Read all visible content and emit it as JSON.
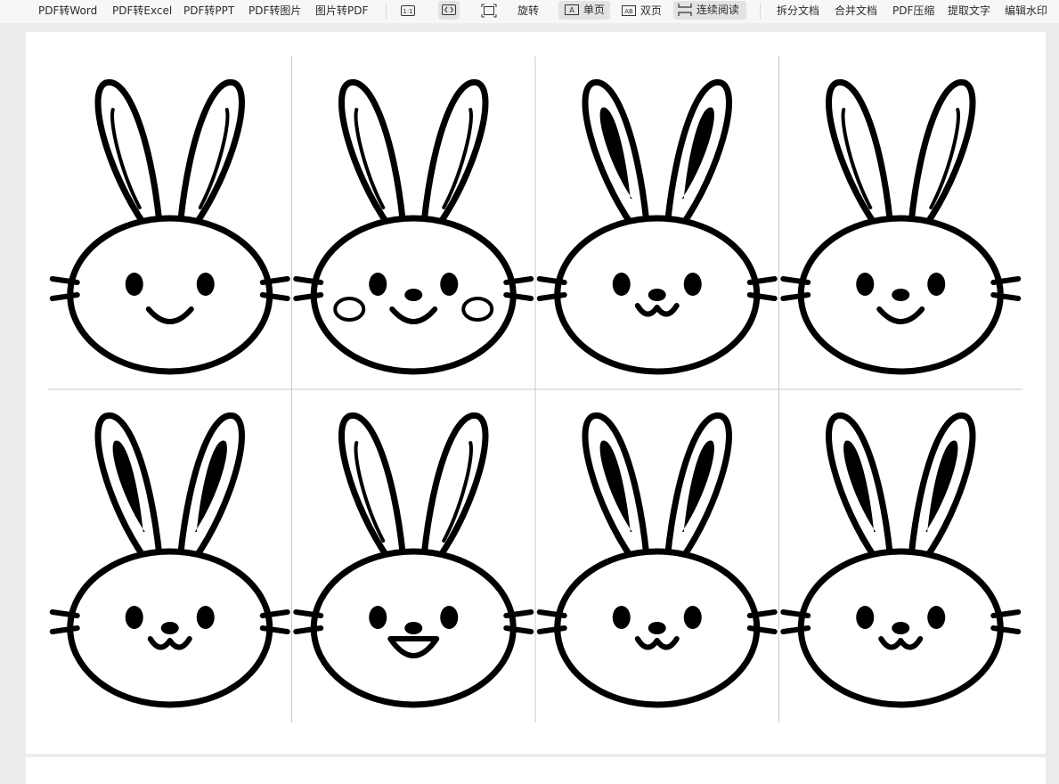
{
  "toolbar": {
    "pdf_to_word": "PDF转Word",
    "pdf_to_excel": "PDF转Excel",
    "pdf_to_ppt": "PDF转PPT",
    "pdf_to_image": "PDF转图片",
    "image_to_pdf": "图片转PDF",
    "actual_size_icon": "one-to-one-icon",
    "fit_width_icon": "fit-width-icon",
    "fit_page_icon": "fit-page-icon",
    "rotate": "旋转",
    "single_page": "单页",
    "double_page": "双页",
    "continuous_reading": "连续阅读",
    "split_doc": "拆分文档",
    "merge_doc": "合并文档",
    "pdf_compress": "PDF压缩",
    "extract_text": "提取文字",
    "edit_watermark": "编辑水印"
  },
  "document": {
    "content": "bunny-face-sheet",
    "rows": 2,
    "columns": 4,
    "bunnies": [
      {
        "ears": "open",
        "cheeks": false,
        "mouth": "smile",
        "nose": false
      },
      {
        "ears": "open",
        "cheeks": true,
        "mouth": "smile",
        "nose": true
      },
      {
        "ears": "filled",
        "cheeks": false,
        "mouth": "w",
        "nose": true
      },
      {
        "ears": "open",
        "cheeks": false,
        "mouth": "smile",
        "nose": true
      },
      {
        "ears": "filled",
        "cheeks": false,
        "mouth": "w",
        "nose": true
      },
      {
        "ears": "open",
        "cheeks": false,
        "mouth": "open",
        "nose": true
      },
      {
        "ears": "filled",
        "cheeks": false,
        "mouth": "w",
        "nose": true
      },
      {
        "ears": "filled",
        "cheeks": false,
        "mouth": "w",
        "nose": true
      }
    ]
  }
}
